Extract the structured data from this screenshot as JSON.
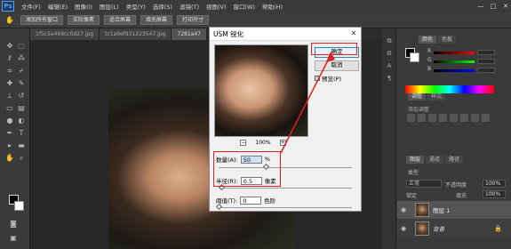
{
  "app": {
    "logo": "Ps",
    "menus": [
      "文件(F)",
      "编辑(E)",
      "图像(I)",
      "图层(L)",
      "类型(Y)",
      "选择(S)",
      "滤镜(T)",
      "视图(V)",
      "窗口(W)",
      "帮助(H)"
    ],
    "window_controls": [
      "—",
      "□",
      "✕"
    ]
  },
  "options_bar": {
    "buttons": [
      "添加所有窗口",
      "实际像素",
      "适合屏幕",
      "填充屏幕",
      "打印尺寸"
    ]
  },
  "doc_tabs": [
    "1f5c5e469cc0d27.jpg",
    "tc1a9ef931223547.jpg",
    "7281a47"
  ],
  "right_panel": {
    "color_tabs": [
      "颜色",
      "色板"
    ],
    "color_labels": [
      "R",
      "G",
      "B"
    ],
    "adjust_tabs": [
      "调整",
      "样式"
    ],
    "adjust_hint": "添加调整",
    "layer_tabs": [
      "图层",
      "通道",
      "路径"
    ],
    "kind_label": "类型",
    "blend_mode": "正常",
    "opacity_label": "不透明度",
    "opacity_value": "100%",
    "lock_label": "锁定",
    "fill_label": "填充",
    "fill_value": "100%",
    "layers": [
      {
        "name": "图层 1"
      },
      {
        "name": "背景"
      }
    ]
  },
  "dialog": {
    "title": "USM 锐化",
    "close": "✕",
    "ok_label": "确定",
    "cancel_label": "取消",
    "preview_label": "预览(P)",
    "preview_checked": true,
    "zoom_minus": "−",
    "zoom_plus": "+",
    "zoom_value": "100%",
    "amount_label": "数量(A):",
    "amount_value": "50",
    "amount_unit": "%",
    "radius_label": "半径(R):",
    "radius_value": "0.5",
    "radius_unit": "像素",
    "threshold_label": "阈值(T):",
    "threshold_value": "0",
    "threshold_unit": "色阶",
    "slider_levels": {
      "amount": 0.35,
      "radius": 0.02,
      "threshold": 0.0
    }
  },
  "colors": {
    "annotation": "#e02020",
    "accent": "#3c7fb1"
  }
}
